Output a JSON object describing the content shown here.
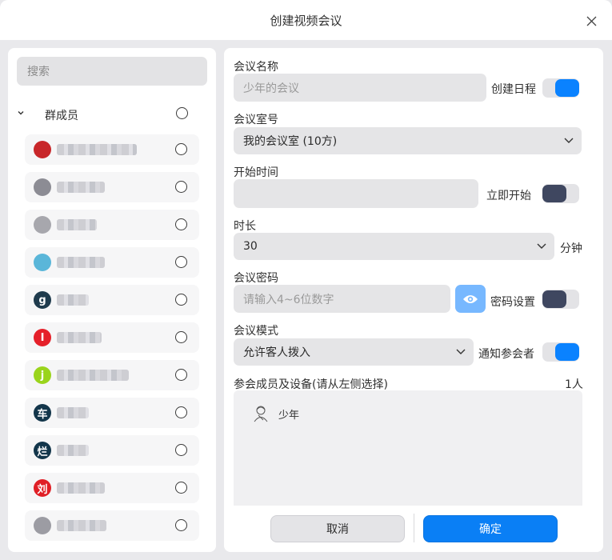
{
  "dialog": {
    "title": "创建视频会议"
  },
  "left": {
    "search_placeholder": "搜索",
    "group_label": "群成员",
    "members": [
      {
        "avatar_color": "#c8272a",
        "avatar_char": ""
      },
      {
        "avatar_color": "#8c8c94",
        "avatar_char": ""
      },
      {
        "avatar_color": "#a7a7ad",
        "avatar_char": ""
      },
      {
        "avatar_color": "#5ab6d9",
        "avatar_char": ""
      },
      {
        "avatar_color": "#1f3b4d",
        "avatar_char": "g"
      },
      {
        "avatar_color": "#e5202a",
        "avatar_char": "I"
      },
      {
        "avatar_color": "#9ad41c",
        "avatar_char": "j"
      },
      {
        "avatar_color": "#13364b",
        "avatar_char": "车"
      },
      {
        "avatar_color": "#13364b",
        "avatar_char": "烂"
      },
      {
        "avatar_color": "#e01f26",
        "avatar_char": "刘"
      },
      {
        "avatar_color": "#9c9ca3",
        "avatar_char": ""
      }
    ]
  },
  "form": {
    "name_label": "会议名称",
    "name_placeholder": "少年的会议",
    "schedule_label": "创建日程",
    "room_label": "会议室号",
    "room_value": "我的会议室 (10方)",
    "start_label": "开始时间",
    "start_now_label": "立即开始",
    "duration_label": "时长",
    "duration_value": "30",
    "duration_unit": "分钟",
    "password_label": "会议密码",
    "password_placeholder": "请输入4~6位数字",
    "password_setting_label": "密码设置",
    "mode_label": "会议模式",
    "mode_value": "允许客人拨入",
    "notify_label": "通知参会者",
    "participants_label": "参会成员及设备(请从左侧选择)",
    "participants_count": "1人",
    "participants": [
      {
        "name": "少年"
      }
    ]
  },
  "toggles": {
    "schedule": true,
    "start_now": false,
    "password": false,
    "notify": true
  },
  "buttons": {
    "cancel": "取消",
    "confirm": "确定"
  },
  "colors": {
    "accent": "#0a82ff",
    "toggle_off": "#3f4760",
    "eye_button": "#77b8ff"
  }
}
